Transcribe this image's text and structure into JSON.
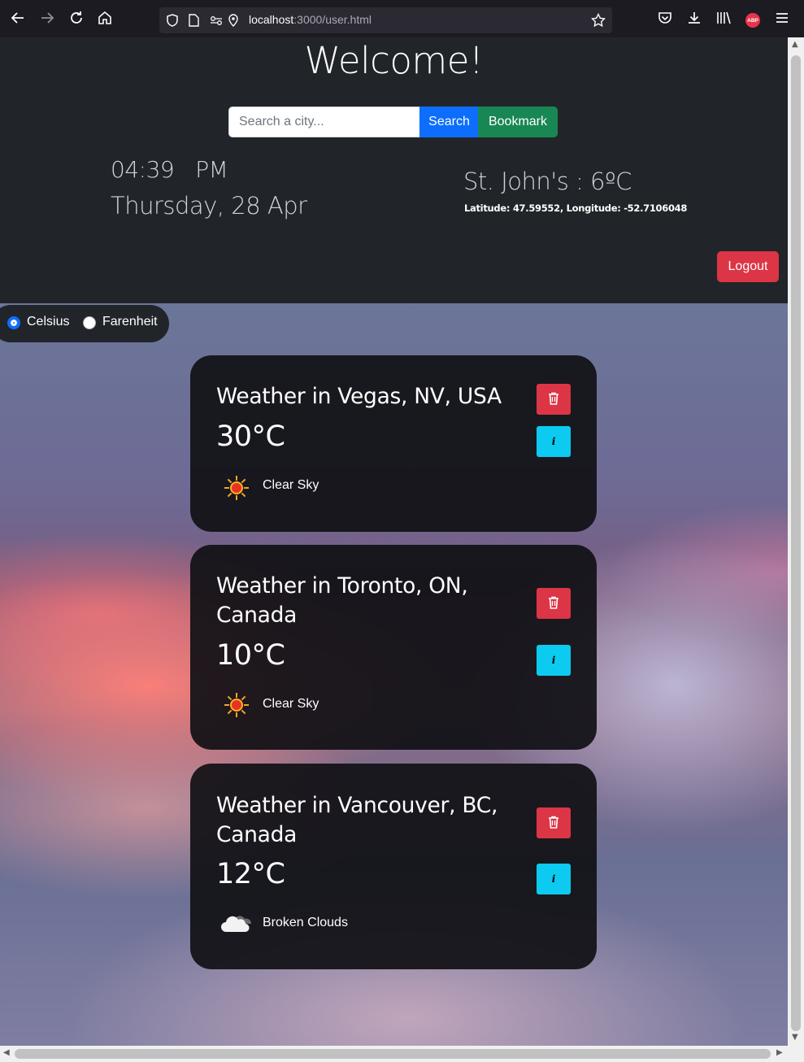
{
  "browser": {
    "url_host": "localhost",
    "url_rest": ":3000/user.html"
  },
  "header": {
    "title": "Welcome!",
    "search_placeholder": "Search a city...",
    "search_label": "Search",
    "bookmark_label": "Bookmark",
    "time": "04:39",
    "ampm": "PM",
    "date": "Thursday, 28 Apr",
    "location_temp": "St. John's : 6ºC",
    "coords": "Latitude: 47.59552, Longitude: -52.7106048",
    "logout_label": "Logout"
  },
  "units": {
    "celsius_label": "Celsius",
    "farenheit_label": "Farenheit",
    "selected": "Celsius"
  },
  "cards": [
    {
      "title": "Weather in Vegas, NV, USA",
      "temp": "30°C",
      "description": "Clear Sky",
      "icon": "sun-icon",
      "info_label": "i"
    },
    {
      "title": "Weather in Toronto, ON, Canada",
      "temp": "10°C",
      "description": "Clear Sky",
      "icon": "sun-icon",
      "info_label": "i"
    },
    {
      "title": "Weather in Vancouver, BC, Canada",
      "temp": "12°C",
      "description": "Broken Clouds",
      "icon": "cloud-icon",
      "info_label": "i"
    }
  ],
  "colors": {
    "header_bg": "#212529",
    "search_button": "#0d6efd",
    "bookmark_button": "#198754",
    "logout_button": "#dc3545",
    "delete_button": "#dc3545",
    "info_button": "#0dcaf0",
    "card_bg": "#111115"
  }
}
